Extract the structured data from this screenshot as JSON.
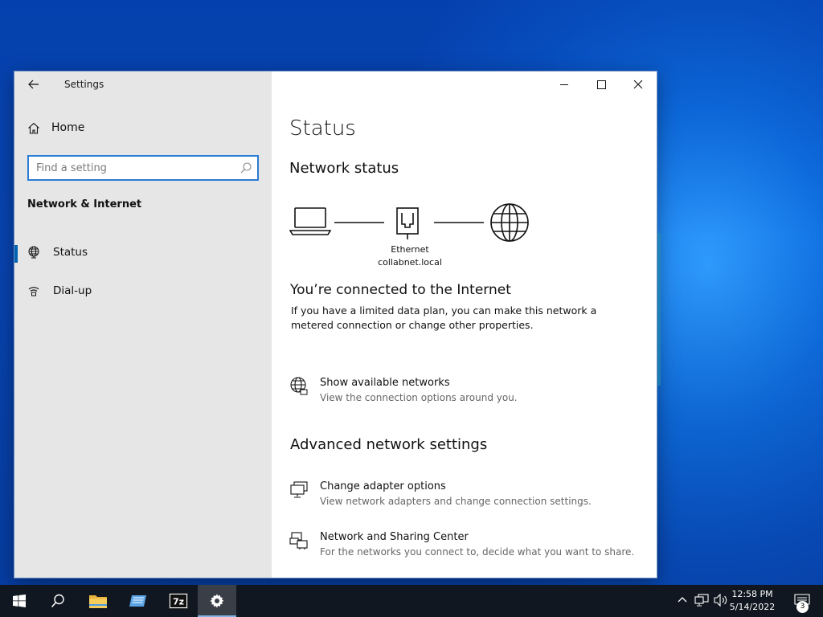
{
  "window": {
    "title": "Settings",
    "controls": {
      "minimize": "minimize",
      "maximize": "maximize",
      "close": "close"
    }
  },
  "sidebar": {
    "home_label": "Home",
    "search_placeholder": "Find a setting",
    "section_label": "Network & Internet",
    "items": [
      {
        "label": "Status",
        "icon": "globe-icon",
        "active": true
      },
      {
        "label": "Dial-up",
        "icon": "dialup-icon",
        "active": false
      }
    ]
  },
  "main": {
    "page_title": "Status",
    "network_status_heading": "Network status",
    "adapter_name": "Ethernet",
    "adapter_domain": "collabnet.local",
    "connected_heading": "You’re connected to the Internet",
    "connected_text": "If you have a limited data plan, you can make this network a metered connection or change other properties.",
    "show_networks": {
      "title": "Show available networks",
      "desc": "View the connection options around you."
    },
    "advanced_heading": "Advanced network settings",
    "adapter_options": {
      "title": "Change adapter options",
      "desc": "View network adapters and change connection settings."
    },
    "sharing_center": {
      "title": "Network and Sharing Center",
      "desc": "For the networks you connect to, decide what you want to share."
    }
  },
  "taskbar": {
    "time": "12:58 PM",
    "date": "5/14/2022",
    "notification_count": "3",
    "accent": "#0063b1"
  }
}
